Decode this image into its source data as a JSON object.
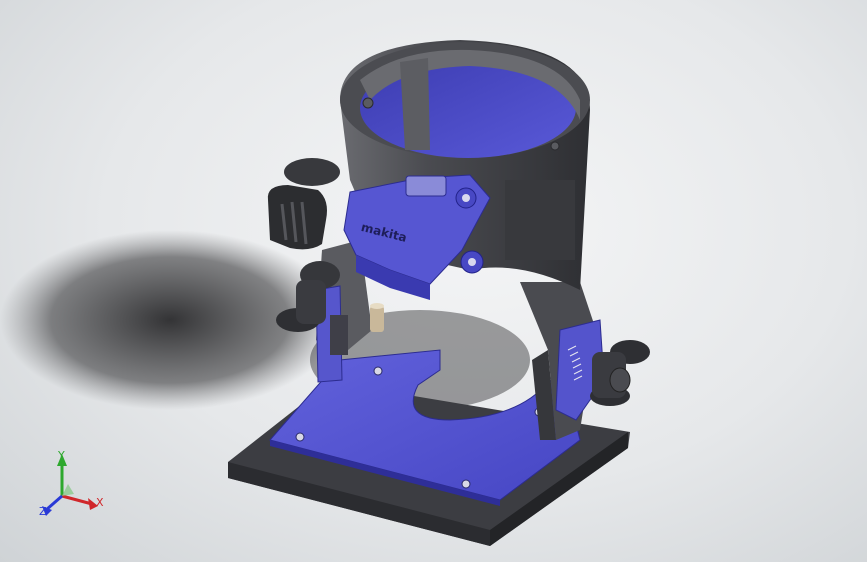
{
  "viewport": {
    "background": "#e7e9eb"
  },
  "model": {
    "brand_logo": "makita",
    "colors": {
      "body": "#4e4f55",
      "body_dark": "#333438",
      "accent": "#5a5ad6",
      "accent_dark": "#3434a8",
      "base_plate": "#3e3f44"
    }
  },
  "triad": {
    "x_label": "X",
    "y_label": "Y",
    "z_label": "Z",
    "x_color": "#d0262a",
    "y_color": "#2ea82e",
    "z_color": "#2a3ad6"
  }
}
